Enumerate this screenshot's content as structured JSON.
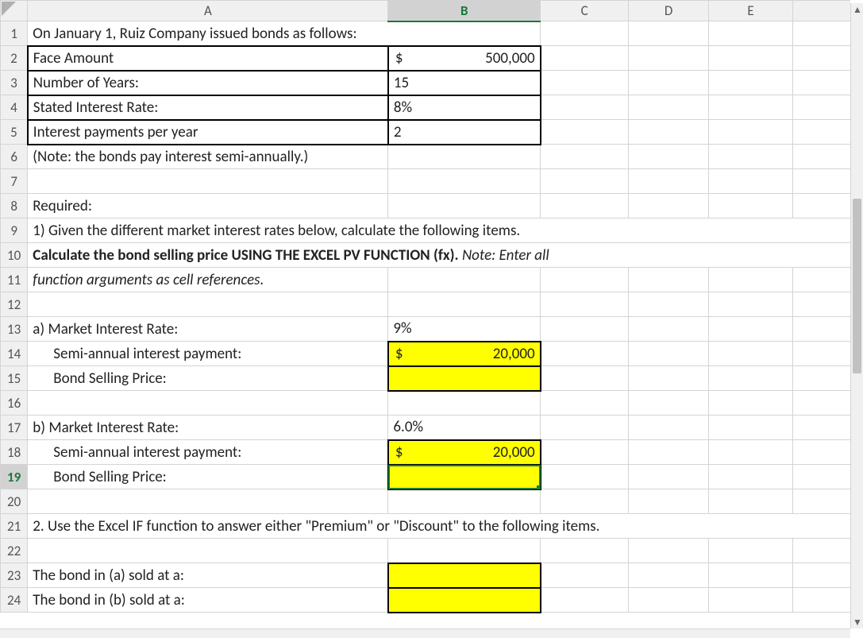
{
  "columns": [
    "A",
    "B",
    "C",
    "D",
    "E"
  ],
  "selected": {
    "row": 19,
    "col": "B",
    "cell": "B19"
  },
  "rows": {
    "r1": {
      "A": "On January 1,  Ruiz Company issued bonds as follows:"
    },
    "r2": {
      "A": "Face Amount",
      "B_sym": "$",
      "B_val": "500,000"
    },
    "r3": {
      "A": "Number of Years:",
      "B": "15"
    },
    "r4": {
      "A": "Stated Interest Rate:",
      "B": "8%"
    },
    "r5": {
      "A": "Interest payments per year",
      "B": "2"
    },
    "r6": {
      "A": "(Note: the bonds pay interest semi-annually.)"
    },
    "r8": {
      "A": "Required:"
    },
    "r9": {
      "A": "1) Given the different market interest rates below, calculate the following items."
    },
    "r10": {
      "A": "Calculate the bond selling price USING THE EXCEL PV FUNCTION (fx). ",
      "A_tail": "Note: Enter all"
    },
    "r11": {
      "A": "function arguments as cell references."
    },
    "r13": {
      "A": "a)  Market Interest Rate:",
      "B": "9%"
    },
    "r14": {
      "A": "Semi-annual interest payment:",
      "B_sym": "$",
      "B_val": "20,000"
    },
    "r15": {
      "A": "Bond Selling Price:"
    },
    "r17": {
      "A": "b)  Market Interest Rate:",
      "B": "6.0%"
    },
    "r18": {
      "A": "Semi-annual interest payment:",
      "B_sym": "$",
      "B_val": "20,000"
    },
    "r19": {
      "A": "Bond Selling Price:"
    },
    "r21": {
      "A": "2. Use the Excel IF function to answer either \"Premium\" or \"Discount\" to the following items."
    },
    "r23": {
      "A": "The bond in (a) sold at a:"
    },
    "r24": {
      "A": "The bond in (b) sold at a:"
    }
  }
}
